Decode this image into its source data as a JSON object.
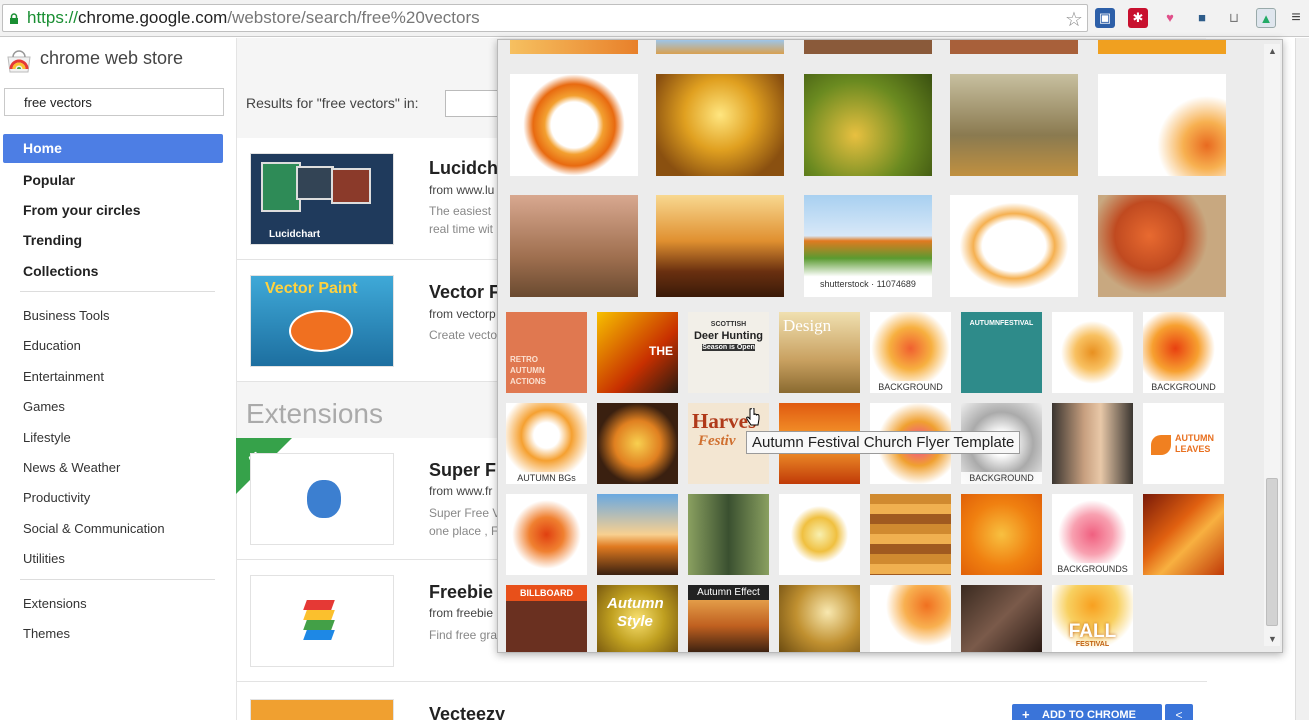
{
  "browser": {
    "url_scheme": "https://",
    "url_host": "chrome.google.com",
    "url_path": "/webstore/search/free%20vectors"
  },
  "sidebar": {
    "store_title": "chrome web store",
    "search_value": "free vectors",
    "nav": [
      "Home",
      "Popular",
      "From your circles",
      "Trending",
      "Collections"
    ],
    "categories": [
      "Business Tools",
      "Education",
      "Entertainment",
      "Games",
      "Lifestyle",
      "News & Weather",
      "Productivity",
      "Social & Communication",
      "Utilities"
    ],
    "other": [
      "Extensions",
      "Themes"
    ]
  },
  "main": {
    "results_label": "Results for \"free vectors\" in:",
    "apps": [
      {
        "title": "Lucidcha",
        "from": "from www.lu",
        "desc1": "The easiest",
        "desc2": "real time wit",
        "thumb_text": "Lucidchart"
      },
      {
        "title": "Vector F",
        "from": "from vectorp",
        "desc1": "Create vecto",
        "desc2": "",
        "thumb_text": "Vector Paint"
      }
    ],
    "extensions_heading": "Extensions",
    "extensions": [
      {
        "title": "Super Fr",
        "from": "from www.fr",
        "desc1": "Super Free V",
        "desc2": "one place , F"
      },
      {
        "title": "Freebie",
        "from": "from freebie",
        "desc1": "Find free gra",
        "desc2": ""
      },
      {
        "title": "Vecteezy",
        "from": "",
        "desc1": "",
        "desc2": ""
      }
    ],
    "add_button": "ADD TO CHROME"
  },
  "popup": {
    "shutterstock_label": "shutterstock · 11074689",
    "row3": {
      "retro": "RETRO\nAUTUMN\nACTIONS",
      "deer_1": "SCOTTISH",
      "deer_2": "Deer Hunting",
      "deer_3": "Season is Open",
      "design": "Design",
      "background": "BACKGROUND",
      "festival": "AUTUMNFESTIVAL",
      "the": "THE"
    },
    "row4": {
      "autumn_bgs": "AUTUMN BGs",
      "harvest": "Harves",
      "festiv": "Festiv",
      "background": "BACKGROUND",
      "autumn_leaves": "AUTUMN LEAVES"
    },
    "row5": {
      "backgrounds": "BACKGROUNDS"
    },
    "row6": {
      "billboard": "BILLBOARD",
      "autumn_style_1": "Autumn",
      "autumn_style_2": "Style",
      "autumn_effect": "Autumn Effect",
      "fall": "FALL",
      "festival_small": "FESTIVAL"
    },
    "tooltip": "Autumn Festival Church Flyer Template"
  },
  "colors": {
    "accent": "#4d7ee4",
    "secure": "#1a8f33"
  }
}
